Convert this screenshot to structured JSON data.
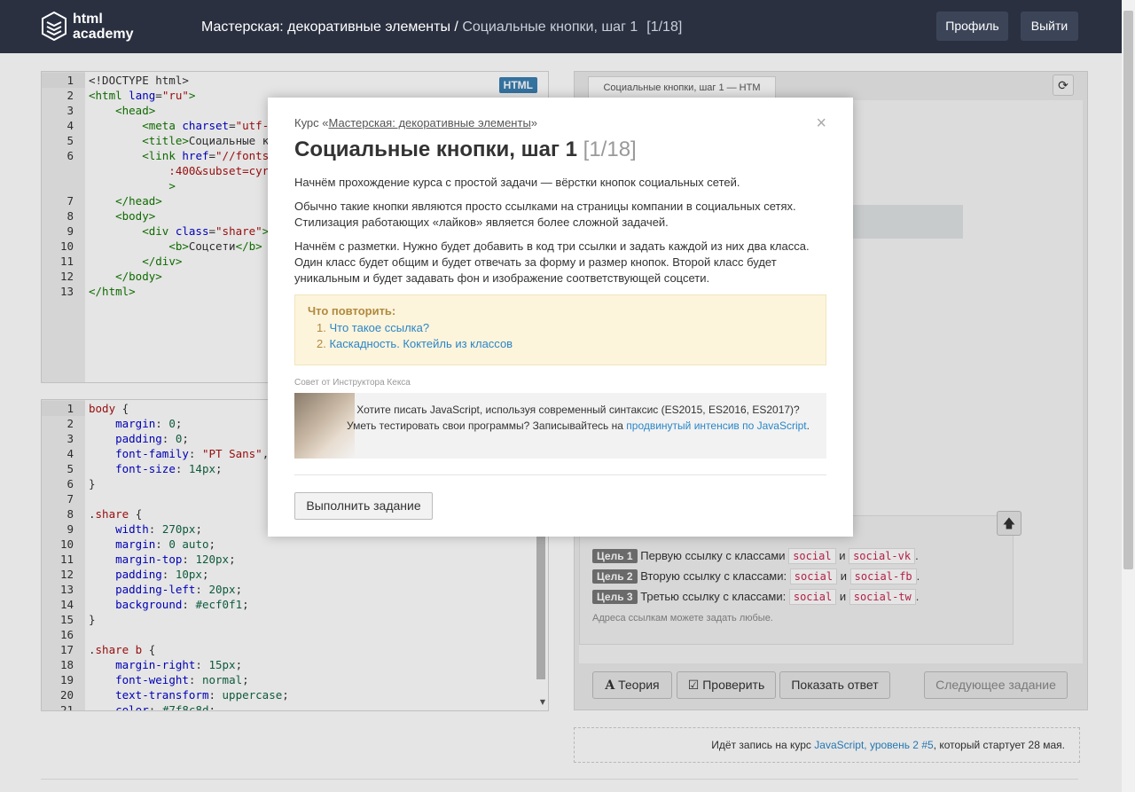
{
  "header": {
    "logo_line1": "html",
    "logo_line2": "academy",
    "course": "Мастерская: декоративные элементы",
    "separator": " / ",
    "step": "Социальные кнопки, шаг 1",
    "counter": "[1/18]",
    "profile_btn": "Профиль",
    "logout_btn": "Выйти"
  },
  "html_editor": {
    "badge": "HTML",
    "line_numbers": [
      "1",
      "2",
      "3",
      "4",
      "5",
      "6",
      "",
      "7",
      "8",
      "9",
      "10",
      "11",
      "12",
      "13"
    ]
  },
  "css_editor": {
    "line_numbers": [
      "1",
      "2",
      "3",
      "4",
      "5",
      "6",
      "7",
      "8",
      "9",
      "10",
      "11",
      "12",
      "13",
      "14",
      "15",
      "16",
      "17",
      "18",
      "19",
      "20",
      "21"
    ]
  },
  "preview": {
    "tab_label": "Социальные кнопки, шаг 1 — HTM"
  },
  "goals": {
    "items": [
      {
        "tag": "Цель 1",
        "text": "Первую ссылку с классами",
        "c1": "social",
        "and": "и",
        "c2": "social-vk"
      },
      {
        "tag": "Цель 2",
        "text": "Вторую ссылку с классами:",
        "c1": "social",
        "and": "и",
        "c2": "social-fb"
      },
      {
        "tag": "Цель 3",
        "text": "Третью ссылку с классами:",
        "c1": "social",
        "and": "и",
        "c2": "social-tw"
      }
    ],
    "note": "Адреса ссылкам можете задать любые."
  },
  "actions": {
    "theory": "Теория",
    "check": "Проверить",
    "show_answer": "Показать ответ",
    "next": "Следующее задание"
  },
  "footer_notice": {
    "prefix": "Идёт запись на курс ",
    "link1": "JavaScript, уровень 2 #5",
    "suffix": ", который стартует 28 мая."
  },
  "modal": {
    "course_prefix": "Курс «",
    "course_link": "Мастерская: декоративные элементы",
    "course_suffix": "»",
    "close": "×",
    "title": "Социальные кнопки, шаг 1",
    "title_counter": "[1/18]",
    "p1": "Начнём прохождение курса с простой задачи — вёрстки кнопок социальных сетей.",
    "p2": "Обычно такие кнопки являются просто ссылками на страницы компании в социальных сетях. Стилизация работающих «лайков» является более сложной задачей.",
    "p3": "Начнём с разметки. Нужно будет добавить в код три ссылки и задать каждой из них два класса. Один класс будет общим и будет отвечать за форму и размер кнопок. Второй класс будет уникальным и будет задавать фон и изображение соответствующей соцсети.",
    "repeat_title": "Что повторить:",
    "repeat_items": [
      "Что такое ссылка?",
      "Каскадность. Коктейль из классов"
    ],
    "tip_label": "Совет от Инструктора Кекса",
    "tip_text1": "Хотите писать JavaScript, используя современный синтаксис (ES2015, ES2016, ES2017)?",
    "tip_text2": "Уметь тестировать свои программы? Записывайтесь на ",
    "tip_link": "продвинутый интенсив по JavaScript",
    "tip_end": ".",
    "exec_btn": "Выполнить задание"
  }
}
